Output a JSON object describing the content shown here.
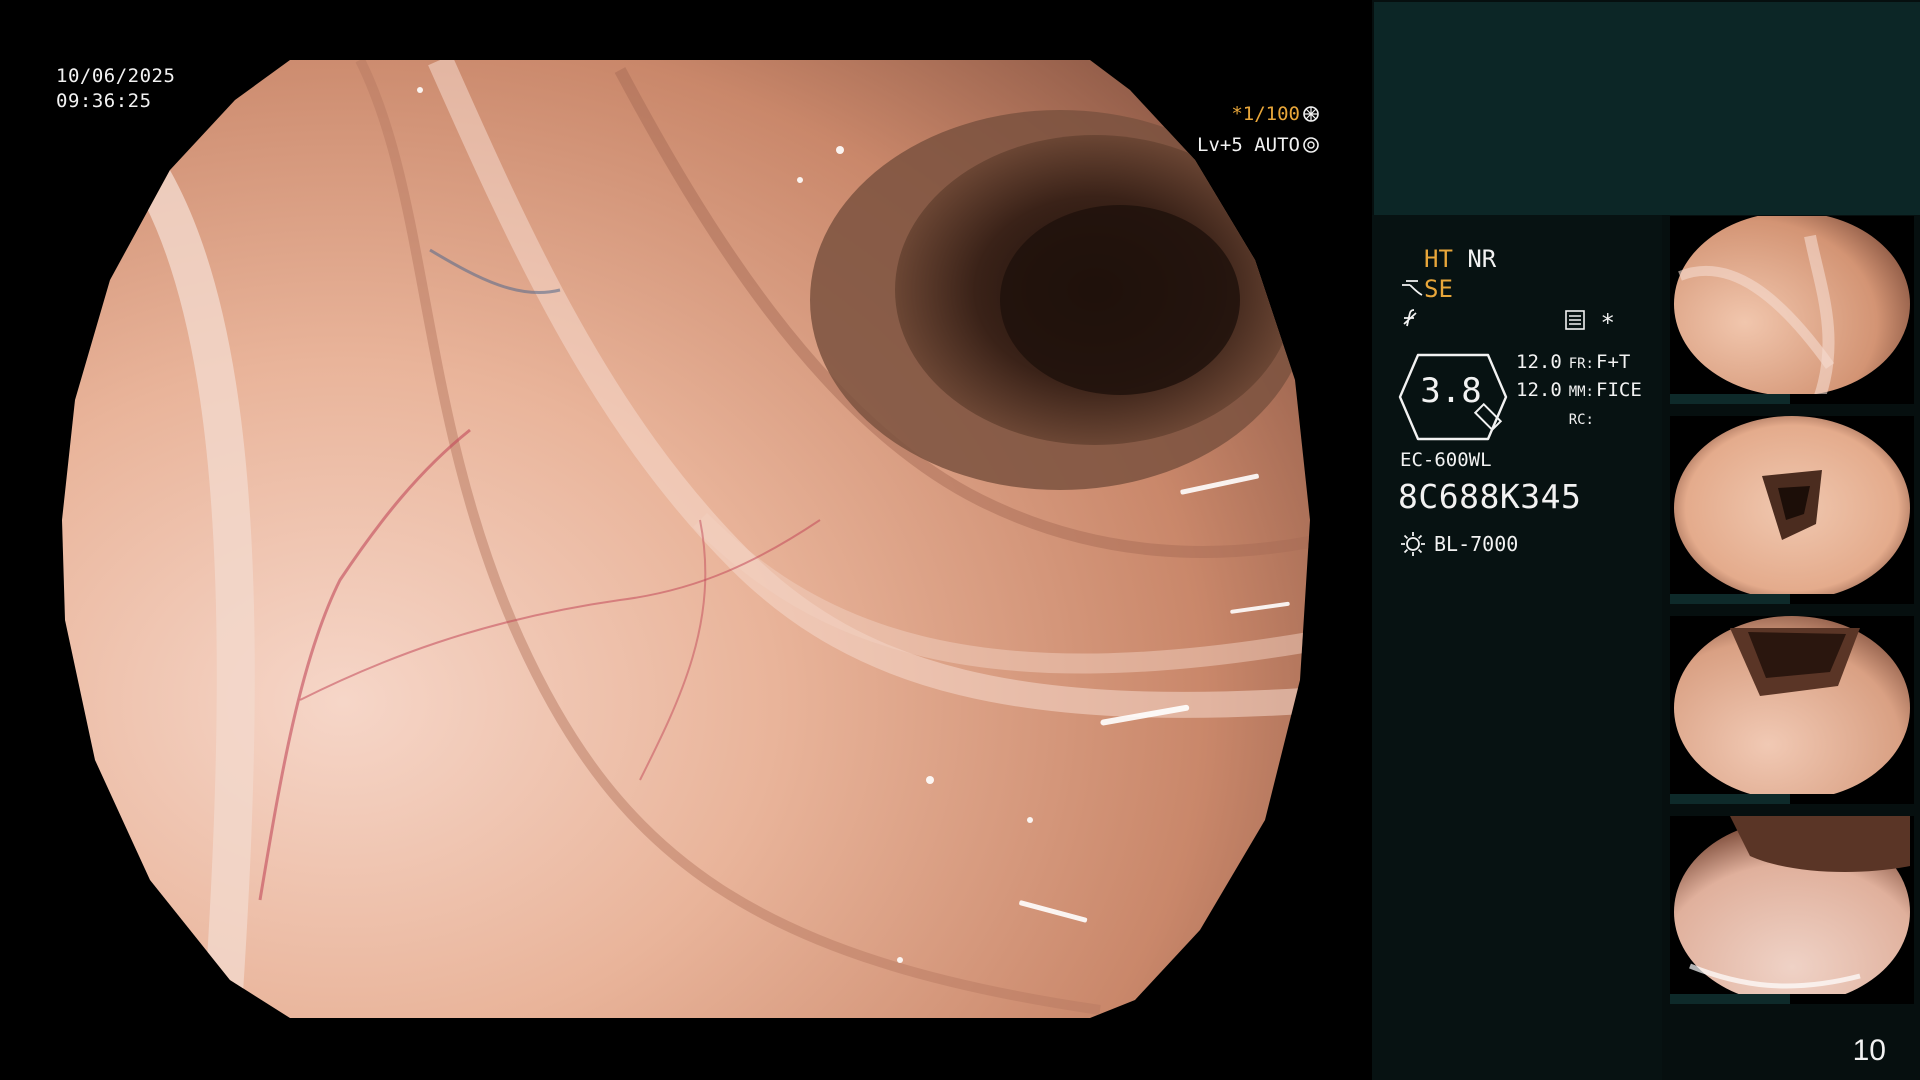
{
  "overlay": {
    "date": "10/06/2025",
    "time": "09:36:25",
    "shutter": "*1/100",
    "exposure": "Lv+5 AUTO"
  },
  "status": {
    "ht": "HT",
    "nr": "NR",
    "se": "SE",
    "f_icon_glyph": "f",
    "filter_asterisk": "*",
    "magnification": "3.8",
    "modes": [
      {
        "value": "12.0",
        "label": "FR:",
        "setting": "F+T"
      },
      {
        "value": "12.0",
        "label": "MM:",
        "setting": "FICE"
      },
      {
        "value": "",
        "label": "RC:",
        "setting": ""
      }
    ],
    "scope_model": "EC-600WL",
    "scope_serial": "8C688K345",
    "light_source": "BL-7000"
  },
  "thumbnails": [
    {
      "name": "thumbnail-1"
    },
    {
      "name": "thumbnail-2"
    },
    {
      "name": "thumbnail-3"
    },
    {
      "name": "thumbnail-4"
    }
  ],
  "page_number": "10",
  "colors": {
    "accent_orange": "#e8a63a",
    "panel_teal": "#0c2626",
    "panel_dark": "#071212",
    "mucosa": "#e3a88d"
  }
}
